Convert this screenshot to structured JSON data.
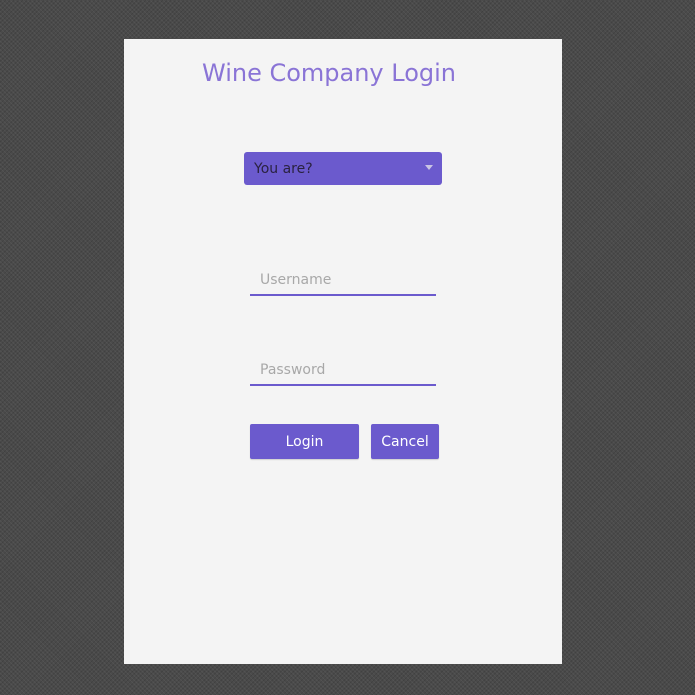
{
  "login_form": {
    "title": "Wine Company Login",
    "role_select": {
      "selected": "You are?"
    },
    "username": {
      "placeholder": "Username",
      "value": ""
    },
    "password": {
      "placeholder": "Password",
      "value": ""
    },
    "buttons": {
      "login_label": "Login",
      "cancel_label": "Cancel"
    }
  },
  "colors": {
    "accent": "#6b5acd",
    "title_text": "#8a74d6",
    "panel_background": "#f4f4f4",
    "page_background": "#4a4a4a"
  },
  "icons": {
    "select_chevron": "chevron-down-icon"
  }
}
